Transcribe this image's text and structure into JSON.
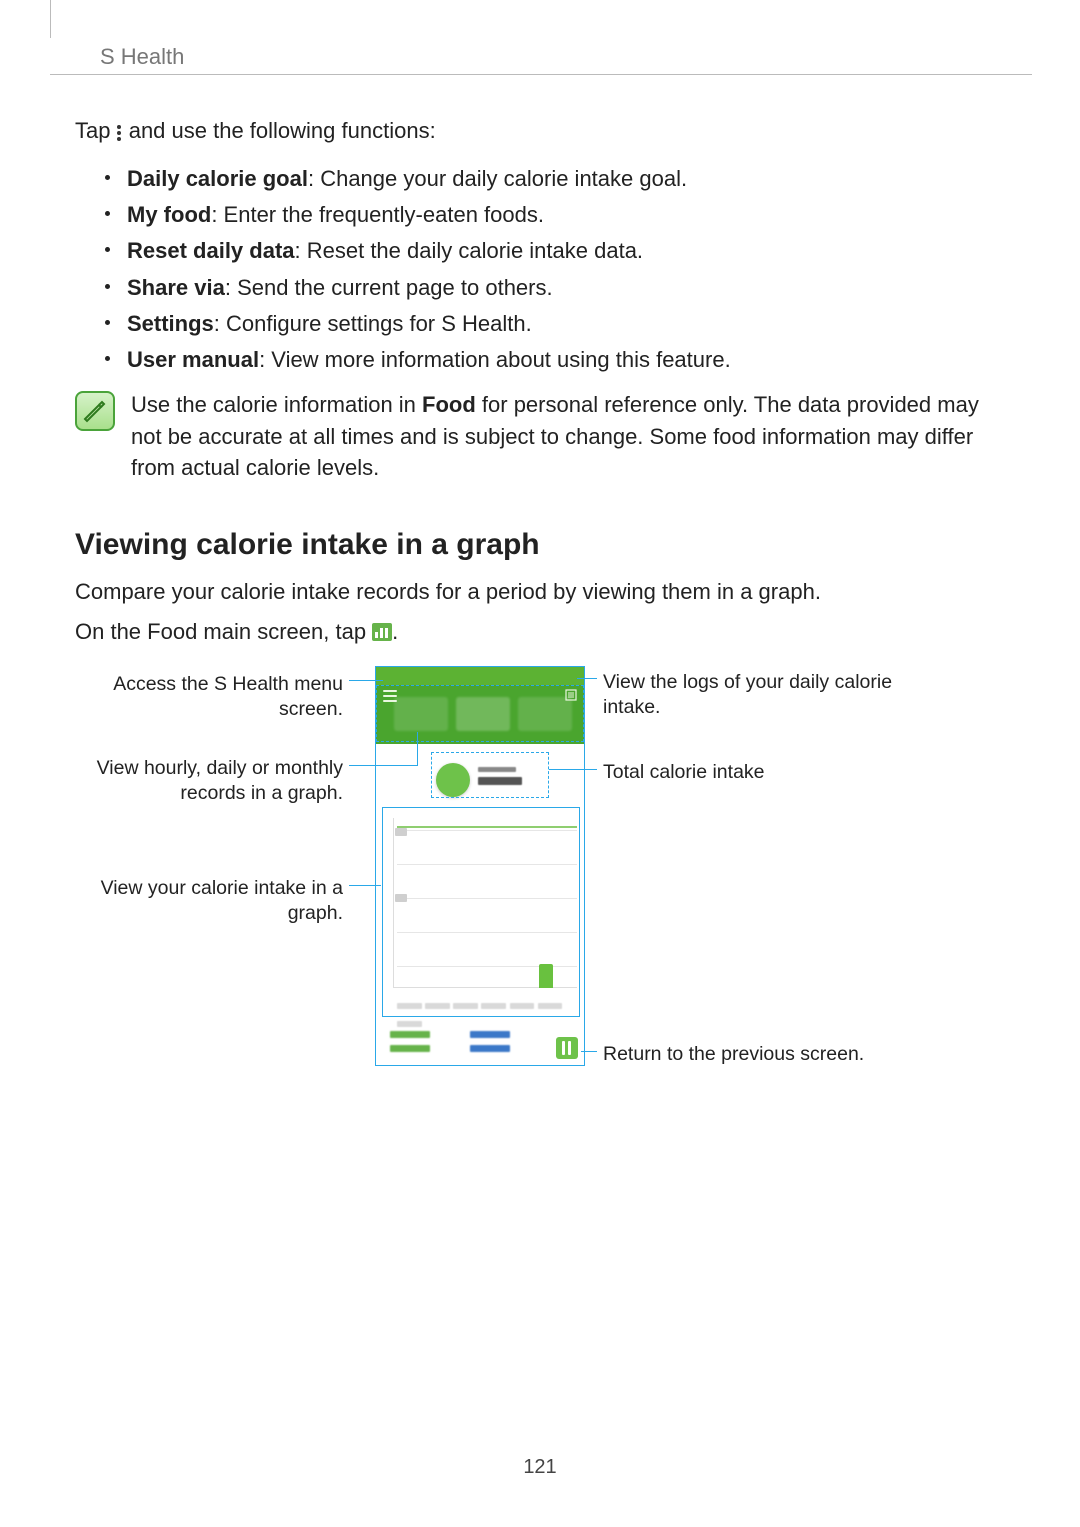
{
  "header": {
    "title": "S Health"
  },
  "intro": {
    "prefix": "Tap ",
    "suffix": " and use the following functions:"
  },
  "functions": [
    {
      "label": "Daily calorie goal",
      "desc": ": Change your daily calorie intake goal."
    },
    {
      "label": "My food",
      "desc": ": Enter the frequently-eaten foods."
    },
    {
      "label": "Reset daily data",
      "desc": ": Reset the daily calorie intake data."
    },
    {
      "label": "Share via",
      "desc": ": Send the current page to others."
    },
    {
      "label": "Settings",
      "desc": ": Configure settings for S Health."
    },
    {
      "label": "User manual",
      "desc": ": View more information about using this feature."
    }
  ],
  "note": {
    "pre": "Use the calorie information in ",
    "bold": "Food",
    "post": " for personal reference only. The data provided may not be accurate at all times and is subject to change. Some food information may differ from actual calorie levels."
  },
  "section2": {
    "heading": "Viewing calorie intake in a graph",
    "p1": "Compare your calorie intake records for a period by viewing them in a graph.",
    "p2a": "On the Food main screen, tap ",
    "p2b": "."
  },
  "callouts": {
    "menu": "Access the S Health menu screen.",
    "period": "View hourly, daily or monthly records in a graph.",
    "graph": "View your calorie intake in a graph.",
    "logs": "View the logs of your daily calorie intake.",
    "total": "Total calorie intake",
    "return": "Return to the previous screen."
  },
  "pageNumber": "121"
}
